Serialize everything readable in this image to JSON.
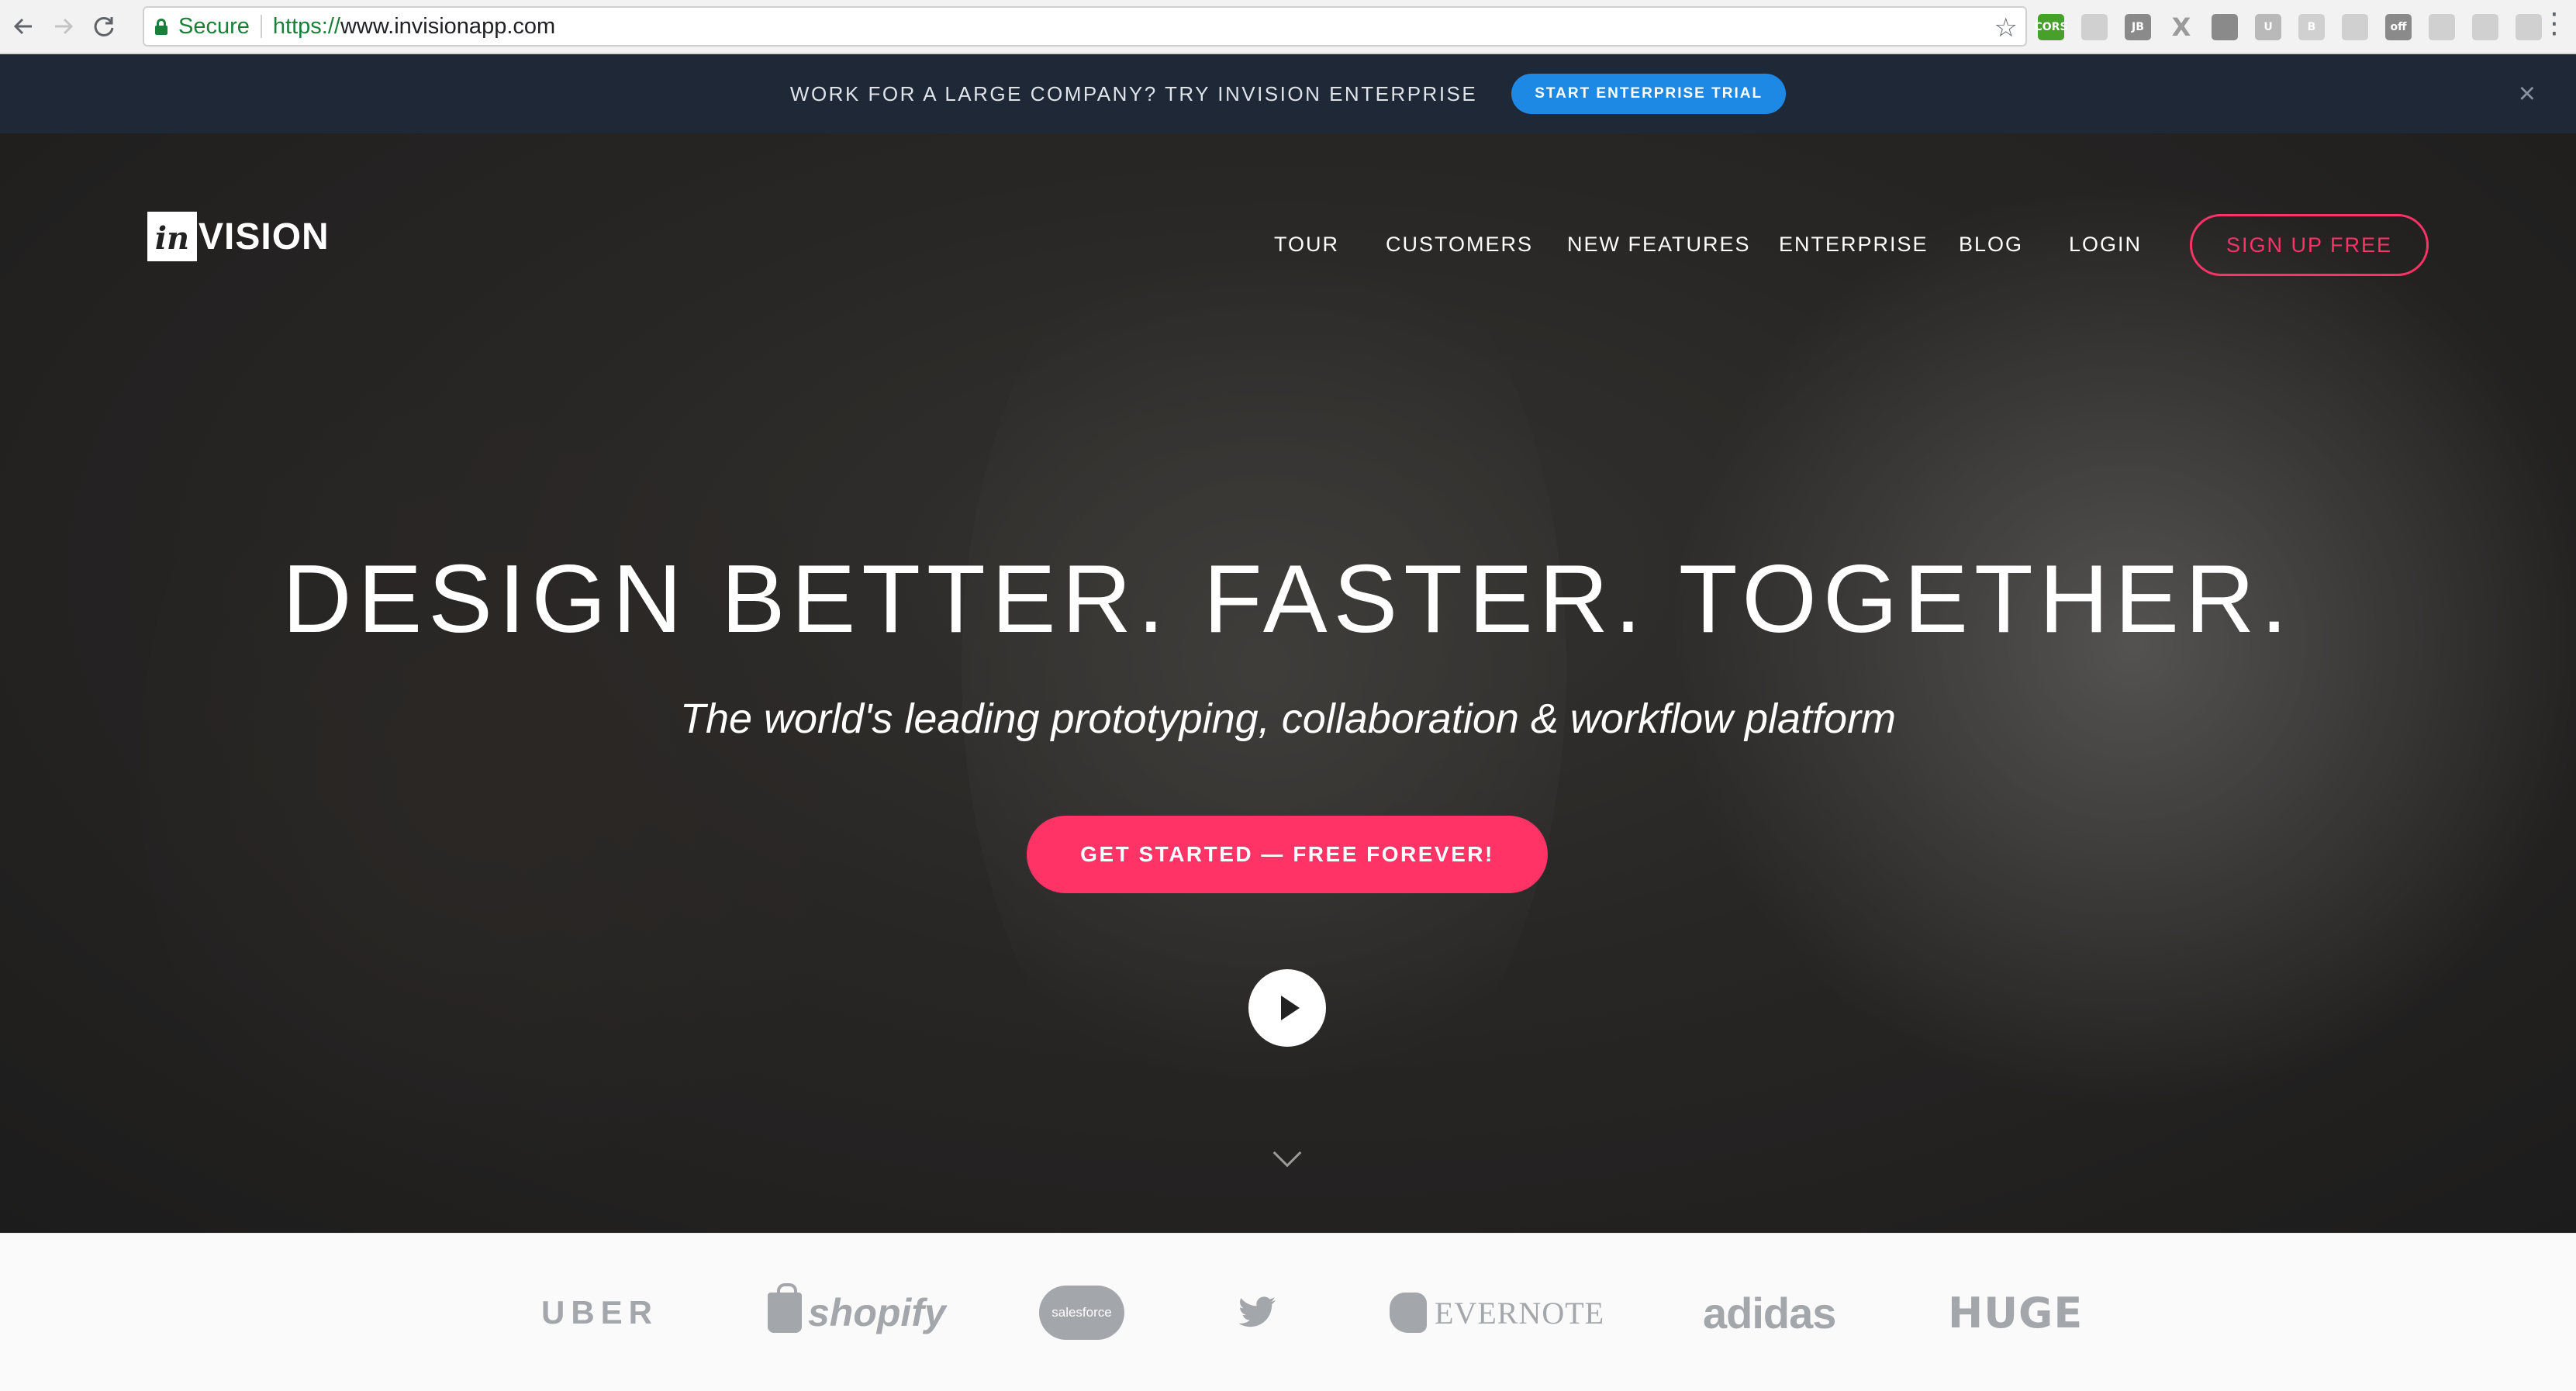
{
  "browser": {
    "secure_label": "Secure",
    "url_scheme": "https://",
    "url_host": "www.invisionapp.com",
    "extensions": [
      {
        "name": "cors-extension-icon",
        "label": "CORS"
      },
      {
        "name": "calendar-extension-icon",
        "label": ""
      },
      {
        "name": "jb-extension-icon",
        "label": "JB"
      },
      {
        "name": "x-extension-icon",
        "label": "X"
      },
      {
        "name": "box-extension-icon",
        "label": ""
      },
      {
        "name": "u-extension-icon",
        "label": "U"
      },
      {
        "name": "b-extension-icon",
        "label": "B"
      },
      {
        "name": "ruler-extension-icon",
        "label": ""
      },
      {
        "name": "off-extension-icon",
        "label": "off"
      },
      {
        "name": "feather-extension-icon",
        "label": ""
      },
      {
        "name": "cast-icon",
        "label": ""
      },
      {
        "name": "sync-extension-icon",
        "label": ""
      }
    ]
  },
  "banner": {
    "text": "WORK FOR A LARGE COMPANY? TRY INVISION ENTERPRISE",
    "button": "START ENTERPRISE TRIAL",
    "close": "×"
  },
  "logo": {
    "box": "in",
    "rest": "VISION"
  },
  "nav": {
    "tour": "TOUR",
    "customers": "CUSTOMERS",
    "new_features": "NEW FEATURES",
    "enterprise": "ENTERPRISE",
    "blog": "BLOG",
    "login": "LOGIN",
    "signup": "SIGN UP FREE"
  },
  "hero": {
    "headline": "DESIGN BETTER. FASTER. TOGETHER.",
    "subline": "The world's leading prototyping, collaboration & workflow platform",
    "cta": "GET STARTED — FREE FOREVER!"
  },
  "customers": {
    "uber": "UBER",
    "shopify": "shopify",
    "salesforce": "salesforce",
    "evernote": "EVERNOTE",
    "adidas": "adidas",
    "huge": "HUGE"
  },
  "colors": {
    "accent": "#ff3366",
    "banner_bg": "#1f2836",
    "banner_button": "#1e88e5",
    "secure_green": "#188038"
  }
}
